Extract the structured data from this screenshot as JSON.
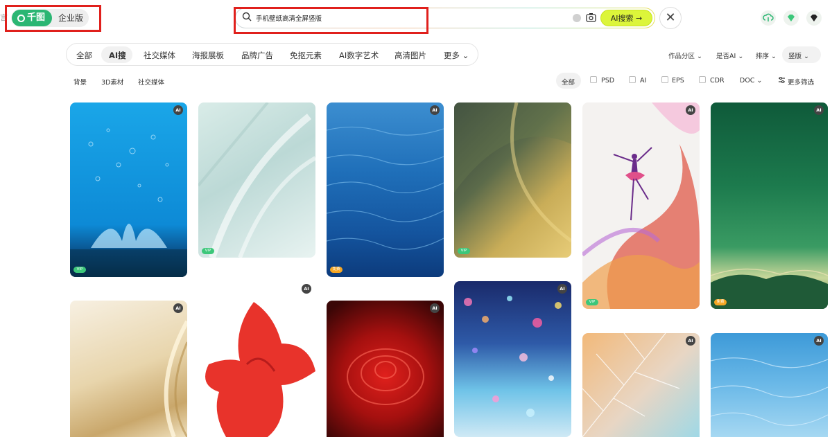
{
  "header": {
    "edge_glyph": "言",
    "logo_text": "千图",
    "edition_label": "企业版",
    "search_value": "手机壁纸高清全屏竖版",
    "ai_search_label": "AI搜索 →",
    "close_label": "✕"
  },
  "nav": {
    "tabs": [
      "全部",
      "AI搜",
      "社交媒体",
      "海报展板",
      "品牌广告",
      "免抠元素",
      "AI数字艺术",
      "高清图片",
      "更多 ⌄"
    ],
    "right_filters": [
      "作品分区 ⌄",
      "是否AI ⌄",
      "排序 ⌄",
      "竖版 ⌄"
    ]
  },
  "subfilters": {
    "categories": [
      "背景",
      "3D素材",
      "社交媒体"
    ],
    "formats_all": "全部",
    "formats": [
      "PSD",
      "AI",
      "EPS",
      "CDR"
    ],
    "doc": "DOC ⌄",
    "more": "更多筛选"
  },
  "badges": {
    "ai": "AI",
    "vip": "VIP",
    "free": "免费"
  },
  "colors": {
    "brand_green": "#2bb673",
    "ai_button": "#dcf53a",
    "highlight_red": "#e0201c"
  }
}
